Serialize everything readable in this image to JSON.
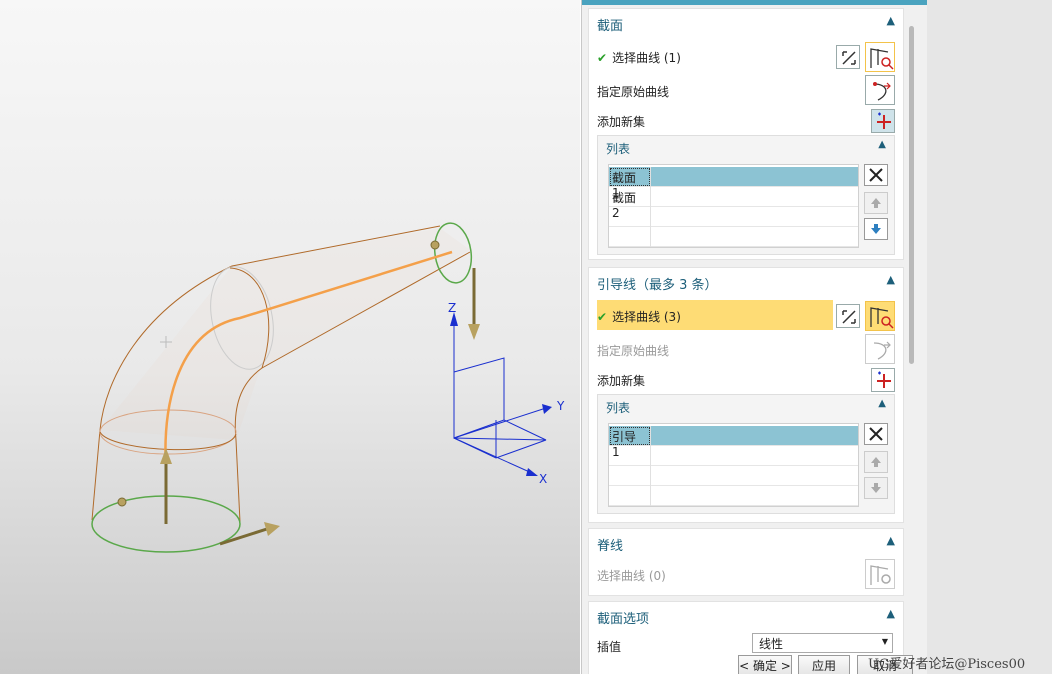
{
  "sections": {
    "section": {
      "title": "截面",
      "select_curve": "选择曲线 (1)",
      "specify_origin": "指定原始曲线",
      "add_new_set": "添加新集",
      "list_title": "列表",
      "list_items": [
        "截面 1",
        "截面 2"
      ]
    },
    "guide": {
      "title": "引导线（最多 3 条）",
      "select_curve": "选择曲线 (3)",
      "specify_origin": "指定原始曲线",
      "add_new_set": "添加新集",
      "list_title": "列表",
      "list_items": [
        "引导 1"
      ]
    },
    "spine": {
      "title": "脊线",
      "select_curve": "选择曲线 (0)"
    },
    "section_options": {
      "title": "截面选项",
      "interp_label": "插值",
      "interp_value": "线性"
    }
  },
  "buttons": {
    "ok": "< 确定 >",
    "apply": "应用",
    "cancel": "取消"
  },
  "axes": {
    "x": "X",
    "y": "Y",
    "z": "Z"
  },
  "watermark": "UG爱好者论坛@Pisces00",
  "colors": {
    "accent": "#1d5f7a",
    "highlight": "#fedc75",
    "selected_row": "#8cc3d3",
    "check": "#2aa02a",
    "guide_curve": "#f4a04a",
    "section_curve": "#5aa84a",
    "axis": "#1a2fcf"
  }
}
